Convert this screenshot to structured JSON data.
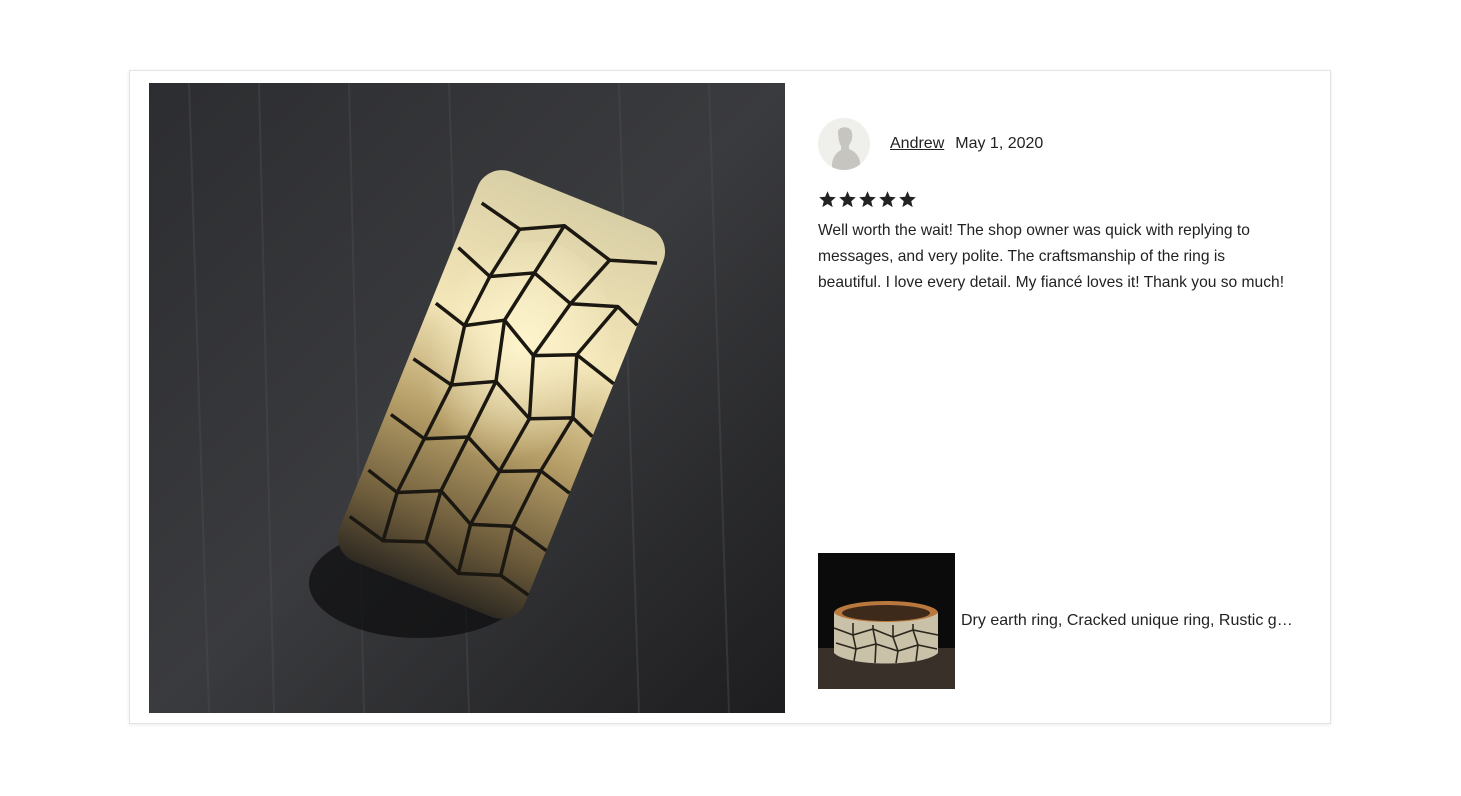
{
  "review": {
    "author": "Andrew",
    "date": "May 1, 2020",
    "rating": 5,
    "rating_max": 5,
    "text": "Well worth the wait! The shop owner was quick with replying to messages, and very polite. The craftsmanship of the ring is beautiful. I love every detail. My fiancé loves it! Thank you so much!"
  },
  "listing": {
    "title": "Dry earth ring, Cracked unique ring, Rustic gold band"
  },
  "icons": {
    "avatar": "default-user-silhouette-icon",
    "star": "filled-star-icon"
  },
  "colors": {
    "text": "#222222",
    "star": "#222222",
    "card_border": "#e3e3e3"
  }
}
